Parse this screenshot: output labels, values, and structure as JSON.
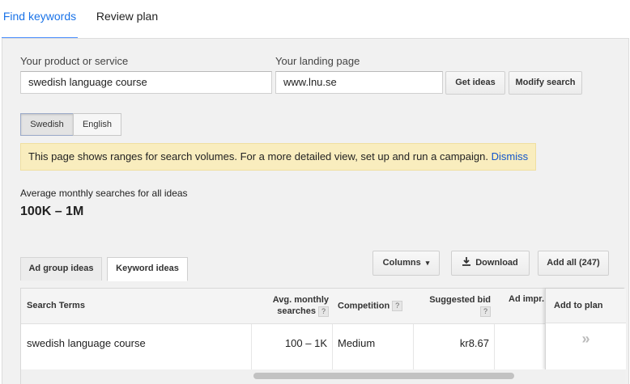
{
  "tabs": {
    "find": "Find keywords",
    "review": "Review plan"
  },
  "form": {
    "product_label": "Your product or service",
    "product_value": "swedish language course",
    "landing_label": "Your landing page",
    "landing_value": "www.lnu.se",
    "get_ideas": "Get ideas",
    "modify_search": "Modify search"
  },
  "languages": {
    "swedish": "Swedish",
    "english": "English",
    "selected": "Swedish"
  },
  "notice": {
    "text": "This page shows ranges for search volumes. For a more detailed view, set up and run a campaign.",
    "dismiss": "Dismiss"
  },
  "summary": {
    "label": "Average monthly searches for all ideas",
    "value": "100K – 1M"
  },
  "subtabs": {
    "ad_group": "Ad group ideas",
    "keyword": "Keyword ideas",
    "active": "Keyword ideas"
  },
  "toolbar": {
    "columns": "Columns",
    "download": "Download",
    "add_all": "Add all (247)"
  },
  "table": {
    "headers": {
      "search_terms": "Search Terms",
      "avg_monthly_1": "Avg. monthly",
      "avg_monthly_2": "searches",
      "competition": "Competition",
      "suggested_bid": "Suggested bid",
      "ad_impr": "Ad impr.",
      "add_to_plan": "Add to plan"
    },
    "rows": [
      {
        "term": "swedish language course",
        "avg": "100 – 1K",
        "competition": "Medium",
        "bid": "kr8.67",
        "impr": ""
      }
    ]
  },
  "icons": {
    "help": "?",
    "add": "»",
    "caret": "▾"
  }
}
